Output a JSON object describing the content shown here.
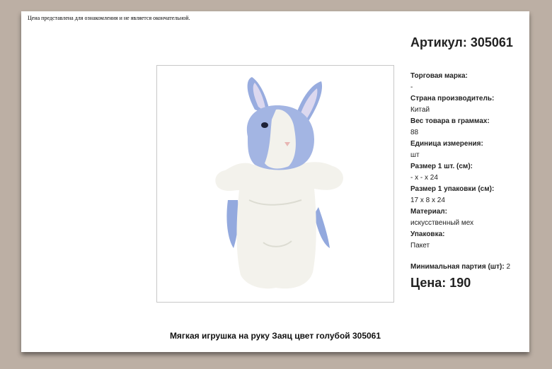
{
  "notice": "Цена представлена для ознакомления и не является окончательной.",
  "article": "Артикул: 305061",
  "specs": [
    {
      "label": "Торговая марка:",
      "value": "-"
    },
    {
      "label": "Страна производитель:",
      "value": "Китай"
    },
    {
      "label": "Вес товара в граммах:",
      "value": "88"
    },
    {
      "label": "Единица измерения:",
      "value": "шт"
    },
    {
      "label": "Размер 1 шт. (см):",
      "value": "- x - x 24"
    },
    {
      "label": "Размер 1 упаковки (см):",
      "value": "17 x 8 x 24"
    },
    {
      "label": "Материал:",
      "value": "искусственный мех"
    },
    {
      "label": "Упаковка:",
      "value": "Пакет"
    }
  ],
  "min_batch": {
    "label": "Минимальная партия (шт):",
    "value": "2"
  },
  "price": "Цена: 190",
  "title": "Мягкая игрушка на руку Заяц цвет голубой 305061",
  "colors": {
    "page_bg": "#bcafa4",
    "sheet_bg": "#ffffff",
    "fur_blue": "#8fa6de",
    "fur_white": "#f4f3ee"
  }
}
